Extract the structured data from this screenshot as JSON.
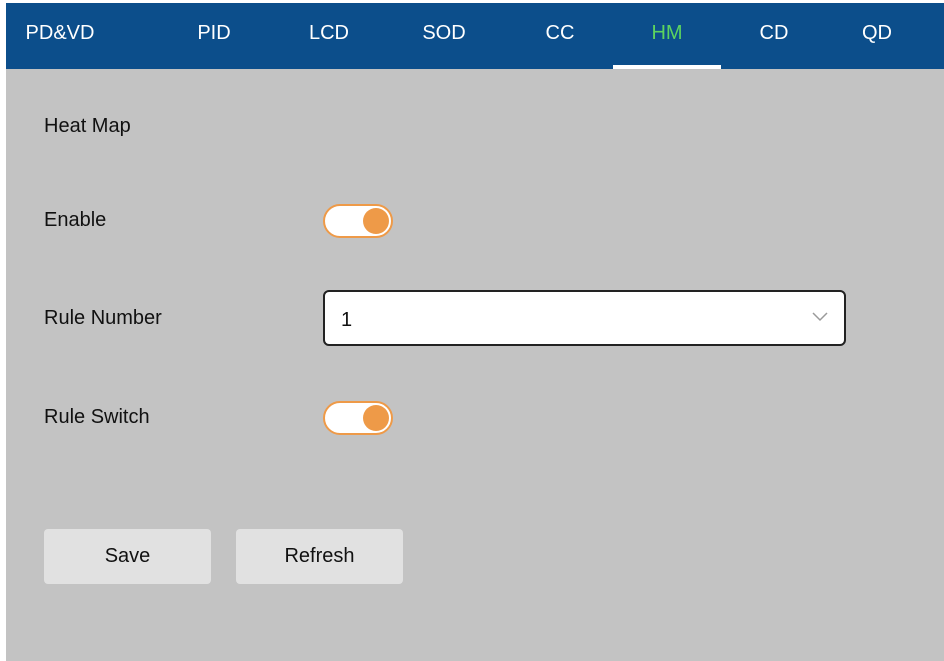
{
  "tabs": [
    {
      "label": "PD&VD",
      "active": false
    },
    {
      "label": "PID",
      "active": false
    },
    {
      "label": "LCD",
      "active": false
    },
    {
      "label": "SOD",
      "active": false
    },
    {
      "label": "CC",
      "active": false
    },
    {
      "label": "HM",
      "active": true
    },
    {
      "label": "CD",
      "active": false
    },
    {
      "label": "QD",
      "active": false
    }
  ],
  "section": {
    "title": "Heat Map"
  },
  "form": {
    "enable": {
      "label": "Enable",
      "on": true
    },
    "rule_number": {
      "label": "Rule Number",
      "value": "1"
    },
    "rule_switch": {
      "label": "Rule Switch",
      "on": true
    }
  },
  "buttons": {
    "save": "Save",
    "refresh": "Refresh"
  },
  "colors": {
    "tabbar": "#0c4e8b",
    "active_tab": "#5cd45f",
    "toggle_accent": "#ee9a48",
    "panel_bg": "#c3c3c3"
  },
  "icons": {
    "dropdown": "chevron-down-icon"
  }
}
